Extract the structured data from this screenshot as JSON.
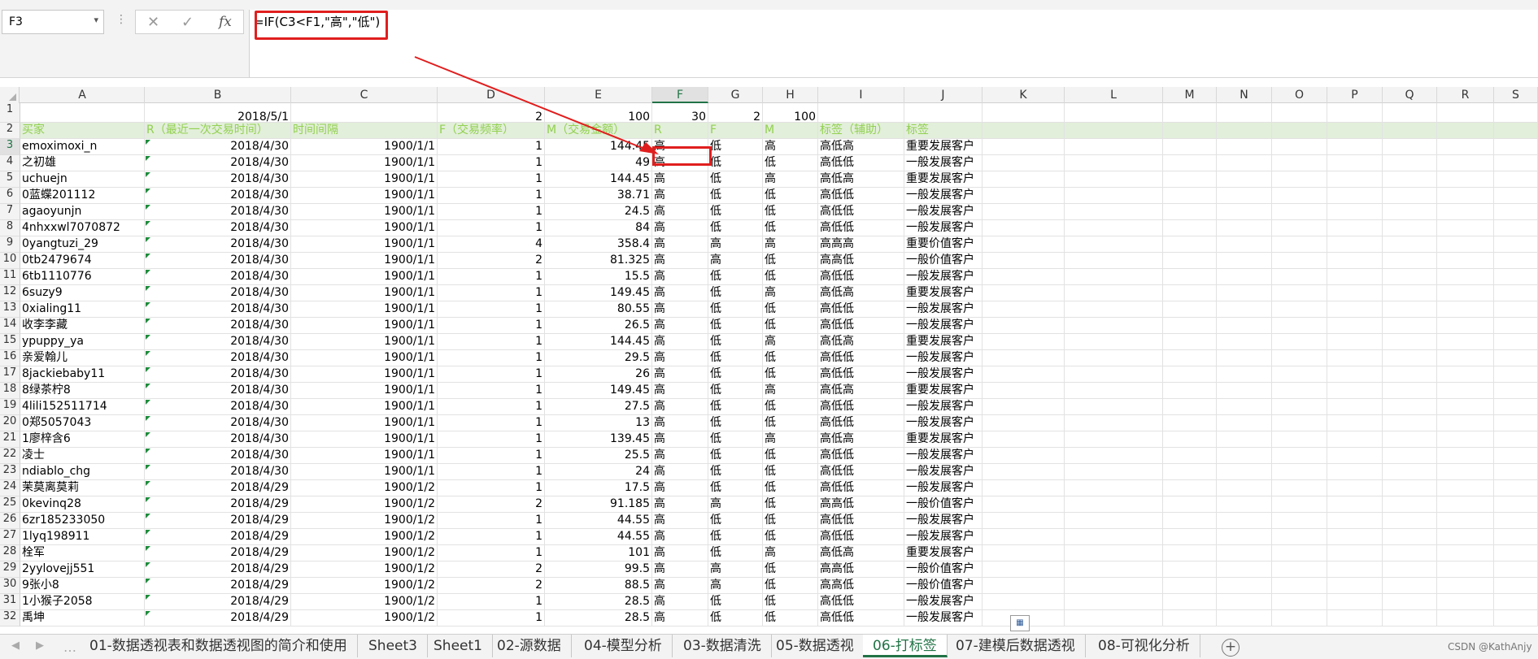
{
  "formula_bar": {
    "name_box": "F3",
    "formula": "=IF(C3<F1,\"高\",\"低\")"
  },
  "columns": [
    "A",
    "B",
    "C",
    "D",
    "E",
    "F",
    "G",
    "H",
    "I",
    "J",
    "K",
    "L",
    "M",
    "N",
    "O",
    "P",
    "Q",
    "R",
    "S"
  ],
  "row1": {
    "num": "1",
    "B": "2018/5/1",
    "D": "2",
    "E": "100",
    "F": "30",
    "G": "2",
    "H": "100"
  },
  "header_row": {
    "num": "2",
    "cells": [
      "买家",
      "R（最近一次交易时间）",
      "时间间隔",
      "F（交易频率）",
      "M（交易金额）",
      "R",
      "F",
      "M",
      "标签（辅助）",
      "标签"
    ]
  },
  "rows": [
    [
      "3",
      "emoximoxi_n",
      "2018/4/30",
      "1900/1/1",
      "1",
      "144.45",
      "高",
      "低",
      "高",
      "高低高",
      "重要发展客户"
    ],
    [
      "4",
      "之初雄",
      "2018/4/30",
      "1900/1/1",
      "1",
      "49",
      "高",
      "低",
      "低",
      "高低低",
      "一般发展客户"
    ],
    [
      "5",
      "uchuejn",
      "2018/4/30",
      "1900/1/1",
      "1",
      "144.45",
      "高",
      "低",
      "高",
      "高低高",
      "重要发展客户"
    ],
    [
      "6",
      "0蓝蝶201112",
      "2018/4/30",
      "1900/1/1",
      "1",
      "38.71",
      "高",
      "低",
      "低",
      "高低低",
      "一般发展客户"
    ],
    [
      "7",
      "agaoyunjn",
      "2018/4/30",
      "1900/1/1",
      "1",
      "24.5",
      "高",
      "低",
      "低",
      "高低低",
      "一般发展客户"
    ],
    [
      "8",
      "4nhxxwl7070872",
      "2018/4/30",
      "1900/1/1",
      "1",
      "84",
      "高",
      "低",
      "低",
      "高低低",
      "一般发展客户"
    ],
    [
      "9",
      "0yangtuzi_29",
      "2018/4/30",
      "1900/1/1",
      "4",
      "358.4",
      "高",
      "高",
      "高",
      "高高高",
      "重要价值客户"
    ],
    [
      "10",
      "0tb2479674",
      "2018/4/30",
      "1900/1/1",
      "2",
      "81.325",
      "高",
      "高",
      "低",
      "高高低",
      "一般价值客户"
    ],
    [
      "11",
      "6tb1110776",
      "2018/4/30",
      "1900/1/1",
      "1",
      "15.5",
      "高",
      "低",
      "低",
      "高低低",
      "一般发展客户"
    ],
    [
      "12",
      "6suzy9",
      "2018/4/30",
      "1900/1/1",
      "1",
      "149.45",
      "高",
      "低",
      "高",
      "高低高",
      "重要发展客户"
    ],
    [
      "13",
      "0xialing11",
      "2018/4/30",
      "1900/1/1",
      "1",
      "80.55",
      "高",
      "低",
      "低",
      "高低低",
      "一般发展客户"
    ],
    [
      "14",
      "收李李藏",
      "2018/4/30",
      "1900/1/1",
      "1",
      "26.5",
      "高",
      "低",
      "低",
      "高低低",
      "一般发展客户"
    ],
    [
      "15",
      "ypuppy_ya",
      "2018/4/30",
      "1900/1/1",
      "1",
      "144.45",
      "高",
      "低",
      "高",
      "高低高",
      "重要发展客户"
    ],
    [
      "16",
      "亲爱翰儿",
      "2018/4/30",
      "1900/1/1",
      "1",
      "29.5",
      "高",
      "低",
      "低",
      "高低低",
      "一般发展客户"
    ],
    [
      "17",
      "8jackiebaby11",
      "2018/4/30",
      "1900/1/1",
      "1",
      "26",
      "高",
      "低",
      "低",
      "高低低",
      "一般发展客户"
    ],
    [
      "18",
      "8绿茶柠8",
      "2018/4/30",
      "1900/1/1",
      "1",
      "149.45",
      "高",
      "低",
      "高",
      "高低高",
      "重要发展客户"
    ],
    [
      "19",
      "4lili152511714",
      "2018/4/30",
      "1900/1/1",
      "1",
      "27.5",
      "高",
      "低",
      "低",
      "高低低",
      "一般发展客户"
    ],
    [
      "20",
      "0郑5057043",
      "2018/4/30",
      "1900/1/1",
      "1",
      "13",
      "高",
      "低",
      "低",
      "高低低",
      "一般发展客户"
    ],
    [
      "21",
      "1廖梓含6",
      "2018/4/30",
      "1900/1/1",
      "1",
      "139.45",
      "高",
      "低",
      "高",
      "高低高",
      "重要发展客户"
    ],
    [
      "22",
      "凌士",
      "2018/4/30",
      "1900/1/1",
      "1",
      "25.5",
      "高",
      "低",
      "低",
      "高低低",
      "一般发展客户"
    ],
    [
      "23",
      "ndiablo_chg",
      "2018/4/30",
      "1900/1/1",
      "1",
      "24",
      "高",
      "低",
      "低",
      "高低低",
      "一般发展客户"
    ],
    [
      "24",
      "茉莫离莫莉",
      "2018/4/29",
      "1900/1/2",
      "1",
      "17.5",
      "高",
      "低",
      "低",
      "高低低",
      "一般发展客户"
    ],
    [
      "25",
      "0kevinq28",
      "2018/4/29",
      "1900/1/2",
      "2",
      "91.185",
      "高",
      "高",
      "低",
      "高高低",
      "一般价值客户"
    ],
    [
      "26",
      "6zr185233050",
      "2018/4/29",
      "1900/1/2",
      "1",
      "44.55",
      "高",
      "低",
      "低",
      "高低低",
      "一般发展客户"
    ],
    [
      "27",
      "1lyq198911",
      "2018/4/29",
      "1900/1/2",
      "1",
      "44.55",
      "高",
      "低",
      "低",
      "高低低",
      "一般发展客户"
    ],
    [
      "28",
      "栓军",
      "2018/4/29",
      "1900/1/2",
      "1",
      "101",
      "高",
      "低",
      "高",
      "高低高",
      "重要发展客户"
    ],
    [
      "29",
      "2yylovejj551",
      "2018/4/29",
      "1900/1/2",
      "2",
      "99.5",
      "高",
      "高",
      "低",
      "高高低",
      "一般价值客户"
    ],
    [
      "30",
      "9张小8",
      "2018/4/29",
      "1900/1/2",
      "2",
      "88.5",
      "高",
      "高",
      "低",
      "高高低",
      "一般价值客户"
    ],
    [
      "31",
      "1小猴子2058",
      "2018/4/29",
      "1900/1/2",
      "1",
      "28.5",
      "高",
      "低",
      "低",
      "高低低",
      "一般发展客户"
    ],
    [
      "32",
      "禹坤",
      "2018/4/29",
      "1900/1/2",
      "1",
      "28.5",
      "高",
      "低",
      "低",
      "高低低",
      "一般发展客户"
    ]
  ],
  "sheet_tabs": [
    "01-数据透视表和数据透视图的简介和使用",
    "Sheet3",
    "Sheet1",
    "02-源数据",
    "04-模型分析",
    "03-数据清洗",
    "05-数据透视",
    "06-打标签",
    "07-建模后数据透视",
    "08-可视化分析"
  ],
  "active_tab": "06-打标签",
  "watermark": "CSDN @KathAnjy",
  "colors": {
    "accent": "#217346",
    "header_fill": "#e2efda",
    "header_text": "#92d050",
    "annotation": "#e01e1e"
  }
}
